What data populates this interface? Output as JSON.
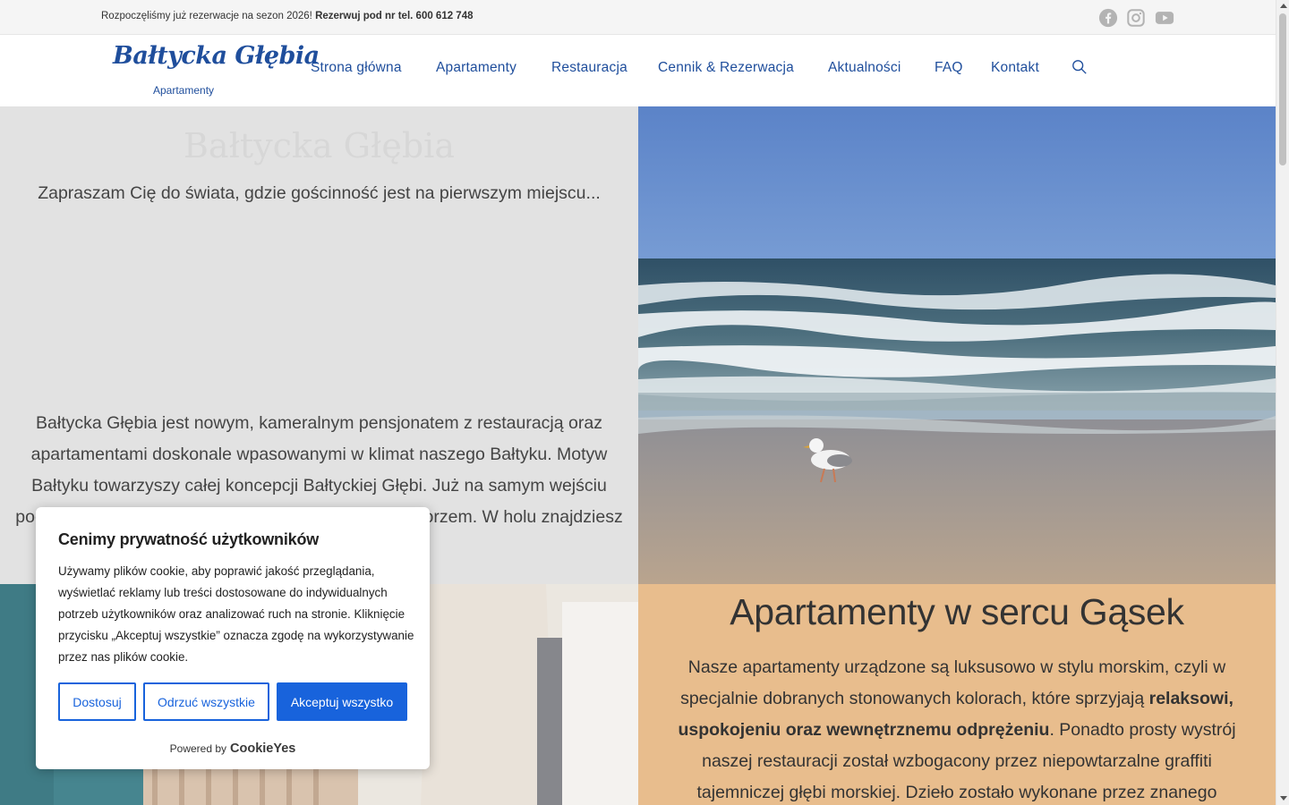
{
  "topbar": {
    "announcement": "Rozpoczęliśmy już rezerwacje na sezon 2026!",
    "reserve_label": "Rezerwuj pod nr tel.",
    "phone": "600 612 748",
    "social_icons": [
      "facebook-icon",
      "instagram-icon",
      "youtube-icon"
    ]
  },
  "header": {
    "logo_title": "Bałtycka Głębia",
    "logo_subtitle": "Apartamenty",
    "nav": {
      "home": "Strona główna",
      "apartments": "Apartamenty",
      "restaurant": "Restauracja",
      "pricing": "Cennik & Rezerwacja",
      "news": "Aktualności",
      "faq": "FAQ",
      "contact": "Kontakt"
    }
  },
  "hero": {
    "title": "Bałtycka Głębia",
    "tagline": "Zapraszam Cię do świata, gdzie gościnność jest na pierwszym miejscu...",
    "description": "Bałtycka Głębia jest nowym, kameralnym pensjonatem z restauracją oraz apartamentami doskonale wpasowanymi w klimat naszego Bałtyku. Motyw Bałtyku towarzyszy całej koncepcji Bałtyckiej Głębi. Już na samym wejściu poczujesz się jak w pięknym zakątku związanym z morzem. W holu znajdziesz wiele morskich motywów."
  },
  "apartments_section": {
    "heading": "Apartamenty w sercu Gąsek",
    "text_part1": "Nasze apartamenty urządzone są luksusowo w stylu morskim, czyli w specjalnie dobranych stonowanych kolorach, które sprzyjają",
    "text_bold": "relaksowi, uspokojeniu oraz wewnętrznemu odprężeniu",
    "text_part2": ". Ponadto prosty wystrój naszej restauracji został wzbogacony przez niepowtarzalne graffiti tajemniczej głębi morskiej. Dzieło zostało wykonane przez znanego"
  },
  "cookie_banner": {
    "title": "Cenimy prywatność użytkowników",
    "text": "Używamy plików cookie, aby poprawić jakość przeglądania, wyświetlać reklamy lub treści dostosowane do indywidualnych potrzeb użytkowników oraz analizować ruch na stronie. Kliknięcie przycisku „Akceptuj wszystkie” oznacza zgodę na wykorzystywanie przez nas plików cookie.",
    "customize_label": "Dostosuj",
    "reject_label": "Odrzuć wszystkie",
    "accept_label": "Akceptuj wszystko",
    "powered_by": "Powered by",
    "brand": "CookieYes"
  },
  "colors": {
    "brand_blue": "#1f4e9c",
    "cookie_blue": "#1863dc",
    "hero_bg": "#e2e2e2",
    "section_sand": "#e8bd8d"
  }
}
